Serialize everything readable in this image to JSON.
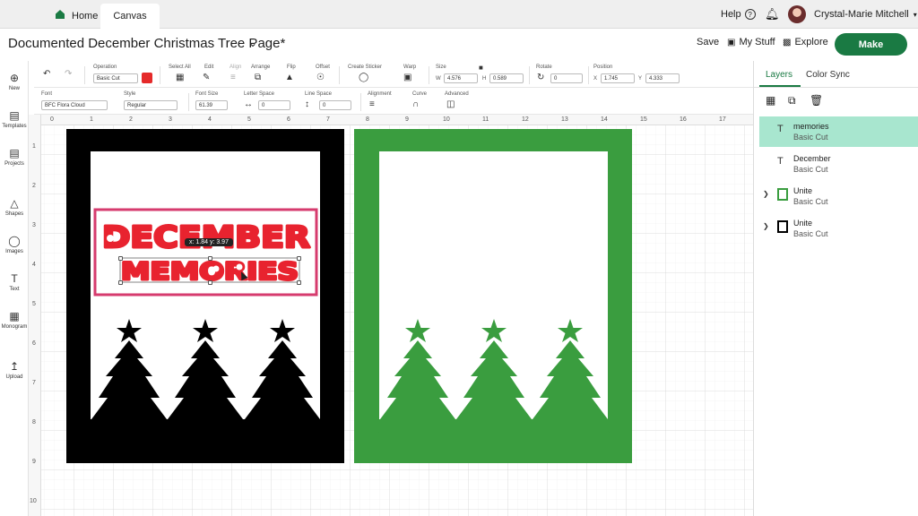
{
  "tabs": {
    "home": "Home",
    "canvas": "Canvas"
  },
  "top_right": {
    "help": "Help",
    "user": "Crystal-Marie Mitchell"
  },
  "title_row": {
    "title": "Documented December Christmas Tree Page*",
    "save": "Save",
    "my_stuff": "My Stuff",
    "explore": "Explore",
    "make": "Make"
  },
  "left_nav": [
    "New",
    "Templates",
    "Projects",
    "Shapes",
    "Images",
    "Text",
    "Monogram",
    "Upload"
  ],
  "toolbar1": {
    "operation_label": "Operation",
    "operation_value": "Basic Cut",
    "operation_color": "#e52a2a",
    "select_all": "Select All",
    "edit": "Edit",
    "align": "Align",
    "arrange": "Arrange",
    "flip": "Flip",
    "offset": "Offset",
    "create_sticker": "Create Sticker",
    "warp": "Warp",
    "size": "Size",
    "w_label": "W",
    "w_value": "4.576",
    "h_label": "H",
    "h_value": "0.589",
    "rotate": "Rotate",
    "rotate_value": "0",
    "position": "Position",
    "x_label": "X",
    "x_value": "1.745",
    "y_label": "Y",
    "y_value": "4.333"
  },
  "toolbar2": {
    "font_label": "Font",
    "font_value": "BFC Flora Cloud",
    "style_label": "Style",
    "style_value": "Regular",
    "font_size_label": "Font Size",
    "font_size_value": "61.39",
    "letter_space_label": "Letter Space",
    "letter_space_value": "0",
    "line_space_label": "Line Space",
    "line_space_value": "0",
    "alignment_label": "Alignment",
    "curve_label": "Curve",
    "advanced_label": "Advanced"
  },
  "ruler": {
    "top": [
      "0",
      "1",
      "2",
      "3",
      "4",
      "5",
      "6",
      "7",
      "8",
      "9",
      "10",
      "11",
      "12",
      "13",
      "14",
      "15",
      "16",
      "17"
    ],
    "left": [
      "1",
      "2",
      "3",
      "4",
      "5",
      "6",
      "7",
      "8",
      "9",
      "10"
    ]
  },
  "canvas": {
    "text_line1": "DECEMBER",
    "text_line2": "MEMORIES",
    "tooltip": "x: 1.84  y: 3.97",
    "black_panel_color": "#000000",
    "green_panel_color": "#3a9d3f",
    "text_color": "#e8232f",
    "selection_color": "#d63b6e"
  },
  "layers_panel": {
    "tab_layers": "Layers",
    "tab_color_sync": "Color Sync",
    "layers": [
      {
        "name": "memories",
        "sub": "Basic Cut",
        "icon": "text-icon",
        "selected": true
      },
      {
        "name": "December",
        "sub": "Basic Cut",
        "icon": "text-icon",
        "selected": false
      },
      {
        "name": "Unite",
        "sub": "Basic Cut",
        "icon": "green-image-icon",
        "selected": false
      },
      {
        "name": "Unite",
        "sub": "Basic Cut",
        "icon": "black-image-icon",
        "selected": false
      }
    ]
  }
}
